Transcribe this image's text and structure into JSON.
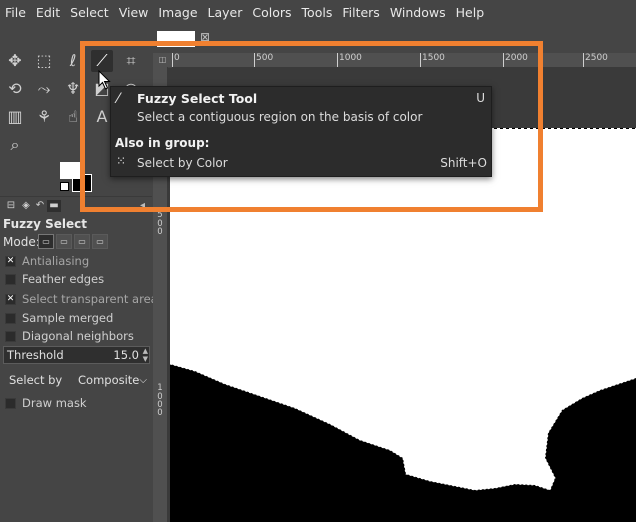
{
  "menubar": {
    "items": [
      "File",
      "Edit",
      "Select",
      "View",
      "Image",
      "Layer",
      "Colors",
      "Tools",
      "Filters",
      "Windows",
      "Help"
    ]
  },
  "toolbox": {
    "tools": [
      {
        "name": "move-tool-icon",
        "glyph": "✥"
      },
      {
        "name": "rect-select-tool-icon",
        "glyph": "⬚"
      },
      {
        "name": "lasso-tool-icon",
        "glyph": "ℓ"
      },
      {
        "name": "fuzzy-select-tool-icon",
        "glyph": "⟋"
      },
      {
        "name": "crop-tool-icon",
        "glyph": "⌗"
      },
      {
        "name": "unified-transform-tool-icon",
        "glyph": "⟲"
      },
      {
        "name": "warp-transform-tool-icon",
        "glyph": "⤳"
      },
      {
        "name": "paintbrush-tool-icon",
        "glyph": "♆"
      },
      {
        "name": "eraser-tool-icon",
        "glyph": "◩"
      },
      {
        "name": "bucket-fill-tool-icon",
        "glyph": "◒"
      },
      {
        "name": "gradient-tool-icon",
        "glyph": "▥"
      },
      {
        "name": "clone-tool-icon",
        "glyph": "⚘"
      },
      {
        "name": "smudge-tool-icon",
        "glyph": "☝"
      },
      {
        "name": "text-tool-icon",
        "glyph": "A"
      },
      {
        "name": "path-tool-icon",
        "glyph": "✎"
      },
      {
        "name": "zoom-tool-icon",
        "glyph": "⌕"
      }
    ]
  },
  "tool_options": {
    "title": "Fuzzy Select",
    "mode_label": "Mode:",
    "options": [
      {
        "label": "Antialiasing",
        "checked": true,
        "dim": true
      },
      {
        "label": "Feather edges",
        "checked": false,
        "dim": false
      },
      {
        "label": "Select transparent areas",
        "checked": true,
        "dim": true
      },
      {
        "label": "Sample merged",
        "checked": false,
        "dim": false
      },
      {
        "label": "Diagonal neighbors",
        "checked": false,
        "dim": false
      }
    ],
    "threshold_label": "Threshold",
    "threshold_value": "15.0",
    "select_by_label": "Select by",
    "select_by_value": "Composite",
    "draw_mask_label": "Draw mask"
  },
  "ruler": {
    "h_labels": [
      "0",
      "500",
      "1000",
      "1500",
      "2000",
      "2500"
    ],
    "v_labels": [
      "5",
      "0",
      "0",
      "1",
      "0",
      "0",
      "0"
    ]
  },
  "tooltip": {
    "title": "Fuzzy Select Tool",
    "shortcut": "U",
    "description": "Select a contiguous region on the basis of color",
    "group_label": "Also in group:",
    "group_item": "Select by Color",
    "group_shortcut": "Shift+O"
  },
  "colors": {
    "highlight": "#f08030",
    "background": "#454545",
    "tooltip": "#2c2c2c"
  }
}
